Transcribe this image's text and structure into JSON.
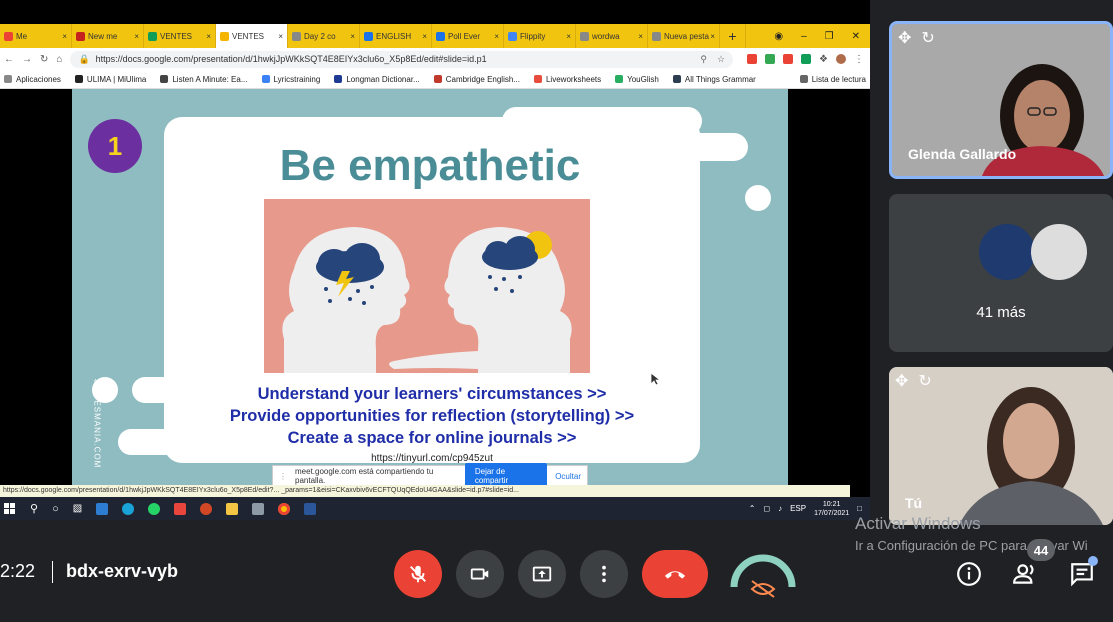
{
  "browser": {
    "tabs": [
      {
        "label": "Me",
        "color": "#ea4335",
        "active": false
      },
      {
        "label": "New me",
        "color": "#c5221f",
        "active": false
      },
      {
        "label": "VENTES",
        "color": "#0f9d58",
        "active": false
      },
      {
        "label": "VENTES",
        "color": "#f4b400",
        "active": true
      },
      {
        "label": "Day 2 co",
        "color": "#888888",
        "active": false
      },
      {
        "label": "ENGLISH",
        "color": "#1a73e8",
        "active": false
      },
      {
        "label": "Poll Ever",
        "color": "#1a73e8",
        "active": false
      },
      {
        "label": "Flippity",
        "color": "#4285f4",
        "active": false
      },
      {
        "label": "wordwa",
        "color": "#888888",
        "active": false
      },
      {
        "label": "Nueva pesta",
        "color": "#888888",
        "active": false
      }
    ],
    "new_tab": "+",
    "url": "https://docs.google.com/presentation/d/1hwkjJpWKkSQT4E8EIYx3clu6o_X5p8Ed/edit#slide=id.p1",
    "bookmarks": [
      {
        "label": "Aplicaciones",
        "color": "#888888"
      },
      {
        "label": "ULIMA | MiUlima",
        "color": "#222222"
      },
      {
        "label": "Listen A Minute: Ea...",
        "color": "#444444"
      },
      {
        "label": "Lyricstraining",
        "color": "#3b82f6"
      },
      {
        "label": "Longman Dictionar...",
        "color": "#1f3a93"
      },
      {
        "label": "Cambridge English...",
        "color": "#c0392b"
      },
      {
        "label": "Liveworksheets",
        "color": "#e74c3c"
      },
      {
        "label": "YouGlish",
        "color": "#27ae60"
      },
      {
        "label": "All Things Grammar",
        "color": "#2c3e50"
      }
    ],
    "reading_list": "Lista de lectura",
    "status_url": "https://docs.google.com/presentation/d/1hwkjJpWKkSQT4E8EIYx3clu6o_X5p8Ed/edit?... _params=1&eisi=CKaxvbiv6vECFTQUqQEdoU4GAA&slide=id.p7#slide=id..."
  },
  "slide": {
    "number": "1",
    "title": "Be empathetic",
    "points": [
      "Understand your learners' circumstances >>",
      "Provide opportunities for reflection (storytelling) >>",
      "Create a space for online journals  >>"
    ],
    "link": "https://tinyurl.com/cp945zut",
    "side_label": "SLIDESMANIA.COM",
    "colors": {
      "bg": "#8fbcc0",
      "title": "#4a8d96",
      "points": "#1f2ea8",
      "badge": "#6b2fa0"
    }
  },
  "share_bar": {
    "message": "meet.google.com está compartiendo tu pantalla.",
    "stop_label": "Dejar de compartir",
    "hide_label": "Ocultar"
  },
  "taskbar": {
    "lang": "ESP",
    "time": "10:21",
    "date": "17/07/2021"
  },
  "participants": {
    "main_name": "Glenda Gallardo",
    "more_label": "41 más",
    "self_label": "Tú"
  },
  "watermark": {
    "line1": "Activar Windows",
    "line2": "Ir a Configuración de PC para activar Wi"
  },
  "meet": {
    "time": "2:22",
    "code": "bdx-exrv-vyb",
    "participant_count": "44"
  }
}
